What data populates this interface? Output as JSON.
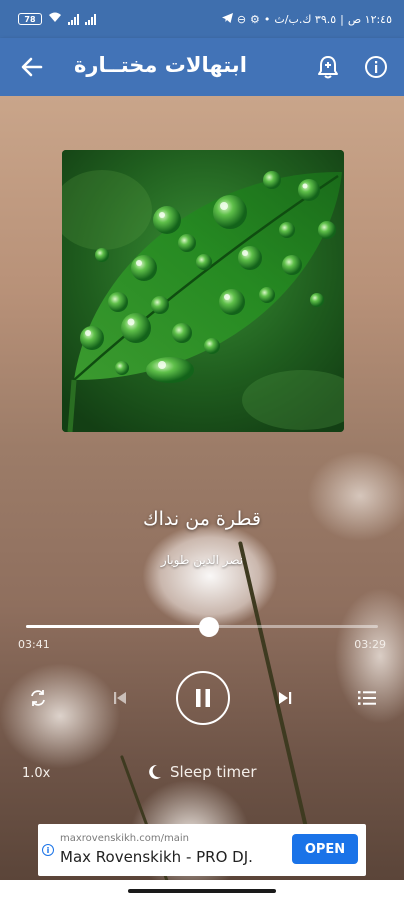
{
  "status_bar": {
    "time": "١٢:٤٥ ص",
    "data_speed": "٣٩.٥ ك.ب/ث",
    "battery": "78"
  },
  "app_bar": {
    "title": "ابتهالات مختــارة",
    "back_icon": "arrow-left-icon",
    "alarm_icon": "bell-alarm-icon",
    "info_icon": "info-icon"
  },
  "player": {
    "track_title": "قطرة من نداك",
    "artist": "نصر الدين طوبار",
    "elapsed": "03:41",
    "duration": "03:29",
    "progress": 0.52,
    "speed": "1.0x",
    "sleep_timer_label": "Sleep timer"
  },
  "ad": {
    "url": "maxrovenskikh.com/main",
    "title": "Max Rovenskikh - PRO DJ.",
    "cta": "OPEN"
  },
  "colors": {
    "app_bar": "#4273b7",
    "status_bar": "#3f6fae",
    "ad_button": "#1a73e8"
  }
}
